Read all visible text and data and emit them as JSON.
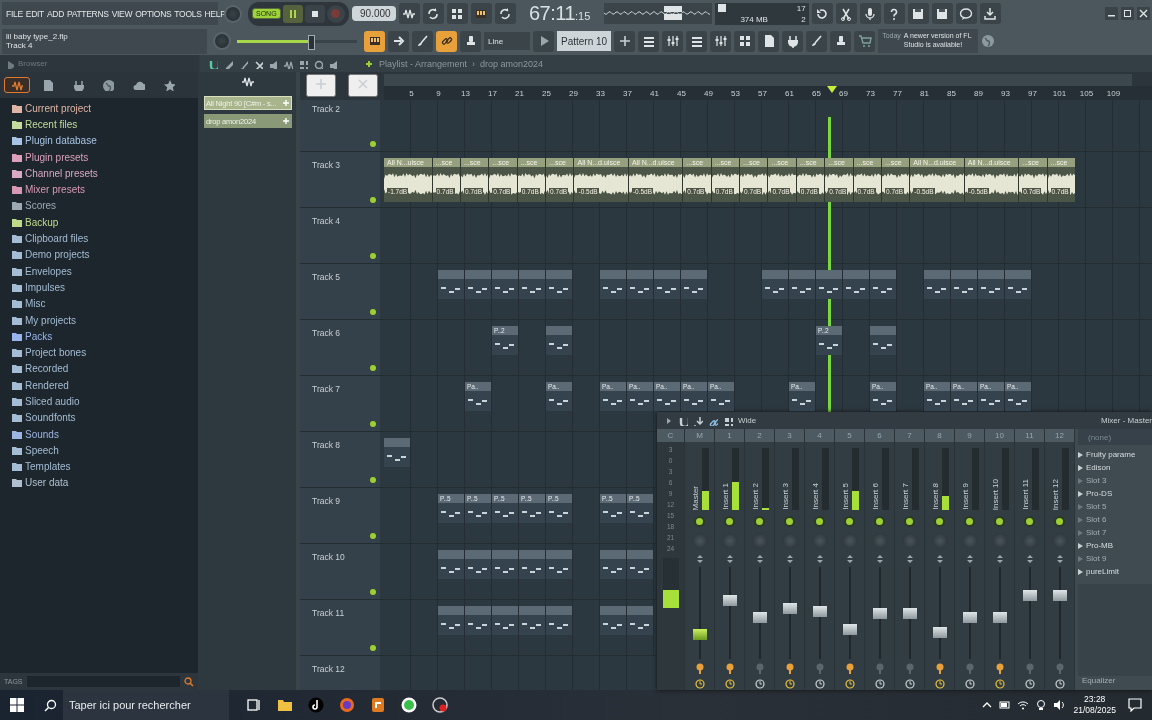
{
  "menu": [
    "FILE",
    "EDIT",
    "ADD",
    "PATTERNS",
    "VIEW",
    "OPTIONS",
    "TOOLS",
    "HELP"
  ],
  "transport": {
    "mode": {
      "label": "SONG",
      "selected": true
    },
    "playing": true,
    "recording": false,
    "tempo": "90.000"
  },
  "time": {
    "value": "67:11",
    "fraction": ":15"
  },
  "memory": {
    "count": "17",
    "ram": "374 MB",
    "voices": "2"
  },
  "hint": {
    "title": "lil baby type_2.flp",
    "text": "Track 4"
  },
  "master_volume": {
    "level": 0.62
  },
  "tool_buttons": [
    {
      "on": true
    },
    {
      "on": false
    },
    {
      "on": false
    },
    {
      "on": true
    },
    {
      "on": false
    }
  ],
  "snap": "Line",
  "pattern": "Pattern 10",
  "news": {
    "when": "Today",
    "text": "A newer version of FL Studio is available!"
  },
  "browser": {
    "title": "Browser",
    "tabs": [
      {
        "selected": true
      },
      {
        "selected": false
      },
      {
        "selected": false
      },
      {
        "selected": false
      },
      {
        "selected": false
      },
      {
        "selected": false
      }
    ],
    "items": [
      {
        "label": "Current project",
        "color": "#e0b4a4"
      },
      {
        "label": "Recent files",
        "color": "#c4dc9c"
      },
      {
        "label": "Plugin database",
        "color": "#a8c4e4"
      },
      {
        "label": "Plugin presets",
        "color": "#dca0bc"
      },
      {
        "label": "Channel presets",
        "color": "#d8a8c4"
      },
      {
        "label": "Mixer presets",
        "color": "#d898b4"
      },
      {
        "label": "Scores",
        "color": "#9ca8b4"
      },
      {
        "label": "Backup",
        "color": "#bcdc8c"
      },
      {
        "label": "Clipboard files",
        "color": "#a4bcd4"
      },
      {
        "label": "Demo projects",
        "color": "#a4bcd4"
      },
      {
        "label": "Envelopes",
        "color": "#a4bcd4"
      },
      {
        "label": "Impulses",
        "color": "#a4bcd4"
      },
      {
        "label": "Misc",
        "color": "#a4bcd4"
      },
      {
        "label": "My projects",
        "color": "#a4bcd4"
      },
      {
        "label": "Packs",
        "color": "#98b4ec"
      },
      {
        "label": "Project bones",
        "color": "#a4bcd4"
      },
      {
        "label": "Recorded",
        "color": "#a4bcd4"
      },
      {
        "label": "Rendered",
        "color": "#a4bcd4"
      },
      {
        "label": "Sliced audio",
        "color": "#a4bcd4"
      },
      {
        "label": "Soundfonts",
        "color": "#a4bcd4"
      },
      {
        "label": "Sounds",
        "color": "#9cb4e4"
      },
      {
        "label": "Speech",
        "color": "#a4bcd4"
      },
      {
        "label": "Templates",
        "color": "#a4bcd4"
      },
      {
        "label": "User data",
        "color": "#b0c0d0"
      }
    ],
    "tags_label": "TAGS"
  },
  "picker": {
    "items": [
      {
        "label": "All Night 90 [C#m - s...",
        "selected": true
      },
      {
        "label": "drop amon2024",
        "selected": false
      }
    ]
  },
  "playlist": {
    "title": "Playlist - Arrangement",
    "separator": "›",
    "pattern": "drop amon2024",
    "ruler": [
      "5",
      "9",
      "13",
      "17",
      "21",
      "25",
      "29",
      "33",
      "37",
      "41",
      "45",
      "49",
      "53",
      "57",
      "61",
      "65",
      "69",
      "73",
      "77",
      "81",
      "85",
      "89",
      "93",
      "97",
      "101",
      "105",
      "109"
    ],
    "playhead": {
      "level": 0.58
    },
    "tracks": [
      {
        "name": "Track 2"
      },
      {
        "name": "Track 3",
        "clips": [
          {
            "kind": "audio",
            "label": "All N...uisce",
            "gain": "-1.7dB"
          },
          {
            "kind": "audio",
            "label": "...sce",
            "gain": "0.7dB"
          },
          {
            "kind": "audio",
            "label": "...sce",
            "gain": "0.7dB"
          },
          {
            "kind": "audio",
            "label": "...sce",
            "gain": "0.7dB"
          },
          {
            "kind": "audio",
            "label": "...sce",
            "gain": "0.7dB"
          },
          {
            "kind": "audio",
            "label": "...sce",
            "gain": "0.7dB"
          },
          {
            "kind": "audio",
            "label": "All N...d.uisce",
            "gain": "-0.5dB"
          },
          {
            "kind": "audio",
            "label": "All N...d.uisce",
            "gain": "-0.5dB"
          },
          {
            "kind": "audio",
            "label": "...sce",
            "gain": "0.7dB"
          },
          {
            "kind": "audio",
            "label": "...sce",
            "gain": "0.7dB"
          },
          {
            "kind": "audio",
            "label": "...sce",
            "gain": "0.7dB"
          },
          {
            "kind": "audio",
            "label": "...sce",
            "gain": "0.7dB"
          },
          {
            "kind": "audio",
            "label": "...sce",
            "gain": "0.7dB"
          },
          {
            "kind": "audio",
            "label": "...sce",
            "gain": "0.7dB"
          },
          {
            "kind": "audio",
            "label": "...sce",
            "gain": "0.7dB"
          },
          {
            "kind": "audio",
            "label": "...sce",
            "gain": "0.7dB"
          },
          {
            "kind": "audio",
            "label": "All N...d.uisce",
            "gain": "-0.5dB"
          },
          {
            "kind": "audio",
            "label": "All N...d.uisce",
            "gain": "-0.5dB"
          },
          {
            "kind": "audio",
            "label": "...sce",
            "gain": "0.7dB"
          },
          {
            "kind": "audio",
            "label": "...sce",
            "gain": "0.7dB"
          }
        ]
      },
      {
        "name": "Track 4"
      },
      {
        "name": "Track 5",
        "clips": [
          {
            "kind": "gap"
          },
          {
            "kind": "gap"
          },
          {
            "kind": "pattern"
          },
          {
            "kind": "pattern"
          },
          {
            "kind": "pattern"
          },
          {
            "kind": "pattern"
          },
          {
            "kind": "pattern"
          },
          {
            "kind": "gap"
          },
          {
            "kind": "pattern"
          },
          {
            "kind": "pattern"
          },
          {
            "kind": "pattern"
          },
          {
            "kind": "pattern"
          },
          {
            "kind": "gap"
          },
          {
            "kind": "gap"
          },
          {
            "kind": "pattern"
          },
          {
            "kind": "pattern"
          },
          {
            "kind": "pattern"
          },
          {
            "kind": "pattern"
          },
          {
            "kind": "pattern"
          },
          {
            "kind": "gap"
          },
          {
            "kind": "pattern"
          },
          {
            "kind": "pattern"
          },
          {
            "kind": "pattern"
          },
          {
            "kind": "pattern"
          }
        ]
      },
      {
        "name": "Track 6",
        "clips": [
          {
            "kind": "gap"
          },
          {
            "kind": "gap"
          },
          {
            "kind": "gap"
          },
          {
            "kind": "gap"
          },
          {
            "kind": "pattern",
            "label": "P..2"
          },
          {
            "kind": "gap"
          },
          {
            "kind": "pattern"
          },
          {
            "kind": "gap"
          },
          {
            "kind": "gap"
          },
          {
            "kind": "gap"
          },
          {
            "kind": "gap"
          },
          {
            "kind": "gap"
          },
          {
            "kind": "gap"
          },
          {
            "kind": "gap"
          },
          {
            "kind": "gap"
          },
          {
            "kind": "gap"
          },
          {
            "kind": "pattern",
            "label": "P..2"
          },
          {
            "kind": "gap"
          },
          {
            "kind": "pattern"
          }
        ]
      },
      {
        "name": "Track 7",
        "clips": [
          {
            "kind": "gap"
          },
          {
            "kind": "gap"
          },
          {
            "kind": "gap"
          },
          {
            "kind": "pattern",
            "label": "Pa.."
          },
          {
            "kind": "gap"
          },
          {
            "kind": "gap"
          },
          {
            "kind": "pattern",
            "label": "Pa.."
          },
          {
            "kind": "gap"
          },
          {
            "kind": "pattern",
            "label": "Pa.."
          },
          {
            "kind": "pattern",
            "label": "Pa.."
          },
          {
            "kind": "pattern",
            "label": "Pa.."
          },
          {
            "kind": "pattern",
            "label": "Pa.."
          },
          {
            "kind": "pattern",
            "label": "Pa.."
          },
          {
            "kind": "gap"
          },
          {
            "kind": "gap"
          },
          {
            "kind": "pattern",
            "label": "Pa.."
          },
          {
            "kind": "gap"
          },
          {
            "kind": "gap"
          },
          {
            "kind": "pattern",
            "label": "Pa.."
          },
          {
            "kind": "gap"
          },
          {
            "kind": "pattern",
            "label": "Pa.."
          },
          {
            "kind": "pattern",
            "label": "Pa.."
          },
          {
            "kind": "pattern",
            "label": "Pa.."
          },
          {
            "kind": "pattern",
            "label": "Pa.."
          }
        ]
      },
      {
        "name": "Track 8",
        "clips": [
          {
            "kind": "pattern"
          }
        ]
      },
      {
        "name": "Track 9",
        "clips": [
          {
            "kind": "gap"
          },
          {
            "kind": "gap"
          },
          {
            "kind": "pattern",
            "label": "P..5"
          },
          {
            "kind": "pattern",
            "label": "P..5"
          },
          {
            "kind": "pattern",
            "label": "P..5"
          },
          {
            "kind": "pattern",
            "label": "P..5"
          },
          {
            "kind": "pattern",
            "label": "P..5"
          },
          {
            "kind": "gap"
          },
          {
            "kind": "pattern",
            "label": "P..5"
          },
          {
            "kind": "pattern",
            "label": "P..5"
          }
        ]
      },
      {
        "name": "Track 10",
        "clips": [
          {
            "kind": "gap"
          },
          {
            "kind": "gap"
          },
          {
            "kind": "pattern"
          },
          {
            "kind": "pattern"
          },
          {
            "kind": "pattern"
          },
          {
            "kind": "pattern"
          },
          {
            "kind": "pattern"
          },
          {
            "kind": "gap"
          },
          {
            "kind": "pattern"
          },
          {
            "kind": "pattern"
          }
        ]
      },
      {
        "name": "Track 11",
        "clips": [
          {
            "kind": "gap"
          },
          {
            "kind": "gap"
          },
          {
            "kind": "pattern"
          },
          {
            "kind": "pattern"
          },
          {
            "kind": "pattern"
          },
          {
            "kind": "pattern"
          },
          {
            "kind": "pattern"
          },
          {
            "kind": "gap"
          },
          {
            "kind": "pattern"
          },
          {
            "kind": "pattern"
          }
        ]
      },
      {
        "name": "Track 12"
      }
    ]
  },
  "mixer": {
    "stereo": "Wide",
    "title": "Mixer - Master",
    "scale": [
      "3",
      "0",
      "3",
      "6",
      "9",
      "12",
      "15",
      "18",
      "21",
      "24"
    ],
    "current": {
      "number": "C",
      "meter": {
        "level": 0.36
      }
    },
    "strips": [
      {
        "number": "M",
        "name": "Master",
        "meter": {
          "level": 0.3
        },
        "fader": {
          "level": 0.24
        },
        "routed": true
      },
      {
        "number": "1",
        "name": "Insert 1",
        "meter": {
          "level": 0.45
        },
        "fader": {
          "level": 0.66
        },
        "routed": true
      },
      {
        "number": "2",
        "name": "Insert 2",
        "meter": {
          "level": 0.04
        },
        "fader": {
          "level": 0.45
        },
        "routed": false
      },
      {
        "number": "3",
        "name": "Insert 3",
        "meter": {
          "level": 0.0
        },
        "fader": {
          "level": 0.56
        },
        "routed": true
      },
      {
        "number": "4",
        "name": "Insert 4",
        "meter": {
          "level": 0.0
        },
        "fader": {
          "level": 0.52
        },
        "routed": false
      },
      {
        "number": "5",
        "name": "Insert 5",
        "meter": {
          "level": 0.3
        },
        "fader": {
          "level": 0.3
        },
        "routed": true
      },
      {
        "number": "6",
        "name": "Insert 6",
        "meter": {
          "level": 0.0
        },
        "fader": {
          "level": 0.5
        },
        "routed": false
      },
      {
        "number": "7",
        "name": "Insert 7",
        "meter": {
          "level": 0.0
        },
        "fader": {
          "level": 0.5
        },
        "routed": false
      },
      {
        "number": "8",
        "name": "Insert 8",
        "meter": {
          "level": 0.22
        },
        "fader": {
          "level": 0.26
        },
        "routed": true
      },
      {
        "number": "9",
        "name": "Insert 9",
        "meter": {
          "level": 0.0
        },
        "fader": {
          "level": 0.45
        },
        "routed": false
      },
      {
        "number": "10",
        "name": "Insert 10",
        "meter": {
          "level": 0.0
        },
        "fader": {
          "level": 0.45
        },
        "routed": true
      },
      {
        "number": "11",
        "name": "Insert 11",
        "meter": {
          "level": 0.0
        },
        "fader": {
          "level": 0.72
        },
        "routed": false
      },
      {
        "number": "12",
        "name": "Insert 12",
        "meter": {
          "level": 0.0
        },
        "fader": {
          "level": 0.72
        },
        "routed": false
      }
    ],
    "input": "(none)",
    "slots": [
      {
        "kind": "plugin",
        "label": "Fruity parame"
      },
      {
        "kind": "plugin",
        "label": "Edison"
      },
      {
        "kind": "empty",
        "label": "Slot 3"
      },
      {
        "kind": "plugin",
        "label": "Pro-DS"
      },
      {
        "kind": "empty",
        "label": "Slot 5"
      },
      {
        "kind": "empty",
        "label": "Slot 6"
      },
      {
        "kind": "empty",
        "label": "Slot 7"
      },
      {
        "kind": "plugin",
        "label": "Pro-MB"
      },
      {
        "kind": "empty",
        "label": "Slot 9"
      },
      {
        "kind": "plugin",
        "label": "pureLimit"
      }
    ],
    "footer": "Equalizer"
  },
  "taskbar": {
    "search": {
      "placeholder": "Taper ici pour rechercher"
    },
    "time": "23:28",
    "date": "21/08/2025"
  }
}
